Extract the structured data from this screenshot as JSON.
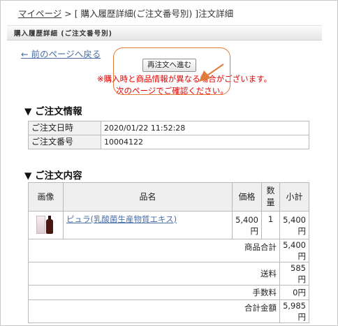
{
  "breadcrumb": {
    "home": "マイページ",
    "separator": " > ",
    "middle": "[ 購入履歴詳細(ご注文番号別) ]",
    "current": "注文詳細"
  },
  "section_header": "購入履歴詳細 (ご注文番号別)",
  "back_link": "← 前のページへ戻る",
  "reorder_button": "再注文へ進む",
  "notice": {
    "line1": "※購入時と商品情報が異なる場合がございます。",
    "line2": "次のページでご確認ください。"
  },
  "order_info": {
    "heading": "▼ ご注文情報",
    "rows": [
      {
        "label": "ご注文日時",
        "value": "2020/01/22 11:52:28"
      },
      {
        "label": "ご注文番号",
        "value": "10004122"
      }
    ]
  },
  "order_contents": {
    "heading": "▼ ご注文内容",
    "headers": {
      "image": "画像",
      "name": "品名",
      "price": "価格",
      "qty": "数量",
      "subtotal": "小計"
    },
    "items": [
      {
        "image": "product-bottle-thumbnail",
        "name": "ピュラ(乳酸菌生産物質エキス)",
        "price": "5,400円",
        "qty": "1",
        "subtotal": "5,400円"
      }
    ],
    "summary": [
      {
        "label": "商品合計",
        "value": "5,400円"
      },
      {
        "label": "送料",
        "value": "585円"
      },
      {
        "label": "手数料",
        "value": "0円"
      },
      {
        "label": "合計金額",
        "value": "5,985円"
      }
    ]
  },
  "colors": {
    "notice": "#e00000",
    "link": "#4a6fa5",
    "highlight": "#e07b3a"
  }
}
